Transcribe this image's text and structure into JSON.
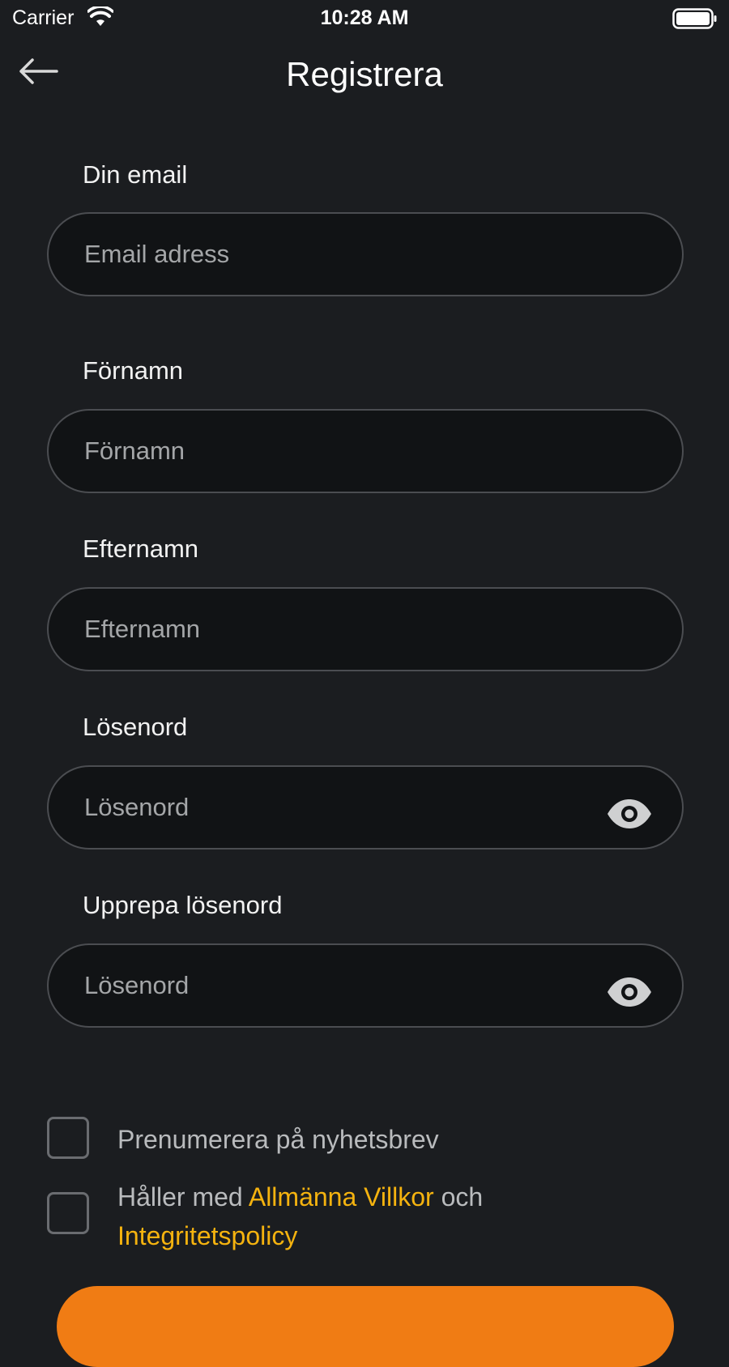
{
  "status_bar": {
    "carrier": "Carrier",
    "time": "10:28 AM"
  },
  "nav": {
    "back_icon": "arrow-left-icon",
    "title": "Registrera"
  },
  "form": {
    "email": {
      "label": "Din email",
      "placeholder": "Email adress",
      "value": ""
    },
    "first_name": {
      "label": "Förnamn",
      "placeholder": "Förnamn",
      "value": ""
    },
    "last_name": {
      "label": "Efternamn",
      "placeholder": "Efternamn",
      "value": ""
    },
    "password": {
      "label": "Lösenord",
      "placeholder": "Lösenord",
      "value": "",
      "toggle_icon": "eye-icon"
    },
    "repeat_password": {
      "label": "Upprepa lösenord",
      "placeholder": "Lösenord",
      "value": "",
      "toggle_icon": "eye-icon"
    }
  },
  "checkboxes": {
    "newsletter": {
      "label": "Prenumerera på nyhetsbrev",
      "checked": false
    },
    "terms": {
      "prefix": "Håller med ",
      "terms_link": "Allmänna Villkor",
      "middle": " och",
      "privacy_link": "Integritetspolicy",
      "checked": false
    }
  },
  "colors": {
    "background": "#1b1d20",
    "field_background": "#111315",
    "field_border": "#4b4d51",
    "link": "#f5b30f",
    "primary_button": "#f07c14"
  }
}
